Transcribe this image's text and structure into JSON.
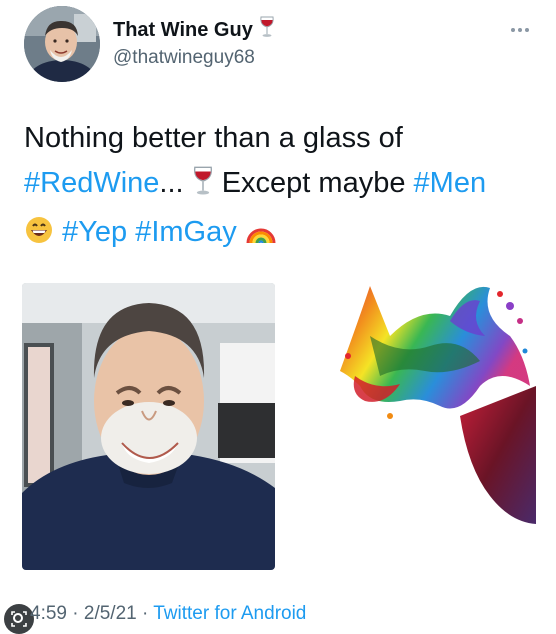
{
  "tweet": {
    "display_name": "That Wine Guy",
    "name_emoji_icon": "wine-glass-icon",
    "handle": "@thatwineguy68",
    "text": {
      "line1": "Nothing better than a glass of",
      "hashtag_redwine": "#RedWine",
      "ellipsis": "...",
      "except": "Except maybe",
      "hashtag_men": "#Men",
      "hashtag_yep": "#Yep",
      "hashtag_imgay": "#ImGay"
    },
    "media": [
      {
        "kind": "photo",
        "description_icon": "selfie-photo"
      },
      {
        "kind": "illustration",
        "description_icon": "rainbow-wine-splash"
      }
    ],
    "footer": {
      "time": "4:59",
      "separator": "·",
      "date": "2/5/21",
      "source": "Twitter for Android"
    }
  },
  "colors": {
    "hashtag": "#1d9bf0",
    "secondary_text": "#536471",
    "text": "#0f1419"
  }
}
